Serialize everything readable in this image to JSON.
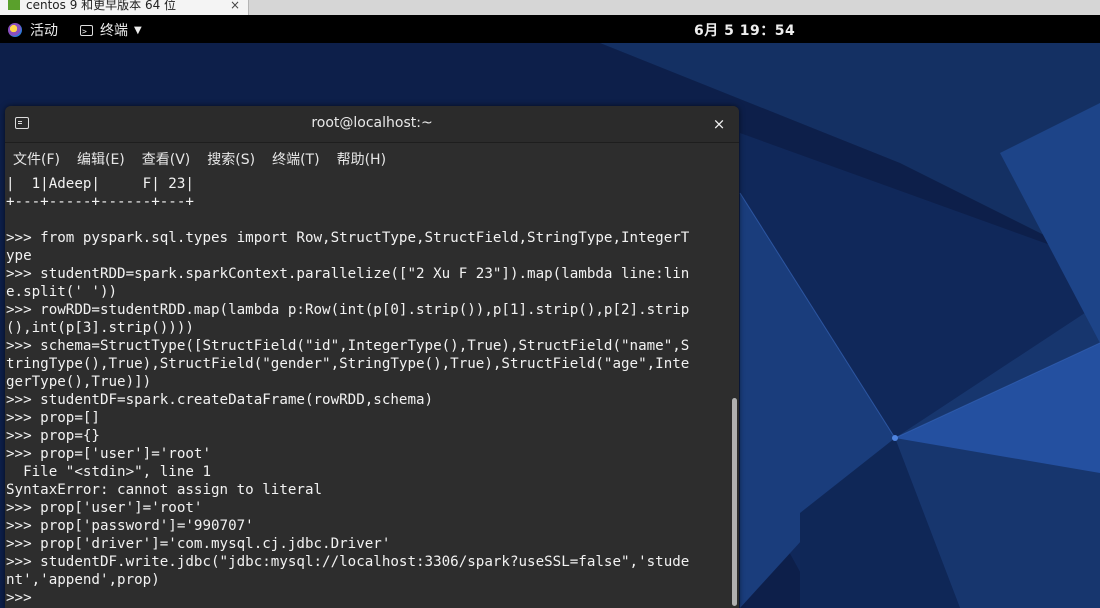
{
  "host_tab": {
    "title": "centos 9 和更早版本 64 位"
  },
  "top_bar": {
    "activities": "活动",
    "app_menu": "终端",
    "clock": "6月 5  19：54"
  },
  "window": {
    "title": "root@localhost:~",
    "close_label": "×"
  },
  "menu": [
    "文件(F)",
    "编辑(E)",
    "查看(V)",
    "搜索(S)",
    "终端(T)",
    "帮助(H)"
  ],
  "terminal": {
    "lines": [
      "|  1|Adeep|     F| 23|",
      "+---+-----+------+---+",
      "",
      ">>> from pyspark.sql.types import Row,StructType,StructField,StringType,IntegerT",
      "ype",
      ">>> studentRDD=spark.sparkContext.parallelize([\"2 Xu F 23\"]).map(lambda line:lin",
      "e.split(' '))",
      ">>> rowRDD=studentRDD.map(lambda p:Row(int(p[0].strip()),p[1].strip(),p[2].strip",
      "(),int(p[3].strip())))",
      ">>> schema=StructType([StructField(\"id\",IntegerType(),True),StructField(\"name\",S",
      "tringType(),True),StructField(\"gender\",StringType(),True),StructField(\"age\",Inte",
      "gerType(),True)])",
      ">>> studentDF=spark.createDataFrame(rowRDD,schema)",
      ">>> prop=[]",
      ">>> prop={}",
      ">>> prop=['user']='root'",
      "  File \"<stdin>\", line 1",
      "SyntaxError: cannot assign to literal",
      ">>> prop['user']='root'",
      ">>> prop['password']='990707'",
      ">>> prop['driver']='com.mysql.cj.jdbc.Driver'",
      ">>> studentDF.write.jdbc(\"jdbc:mysql://localhost:3306/spark?useSSL=false\",'stude",
      "nt','append',prop)"
    ],
    "prompt": ">>> "
  },
  "colors": {
    "terminal_bg": "#2d2d2d",
    "terminal_fg": "#f2f2f2",
    "top_bar_bg": "#000000",
    "desktop_bg": "#0b1a3f"
  }
}
